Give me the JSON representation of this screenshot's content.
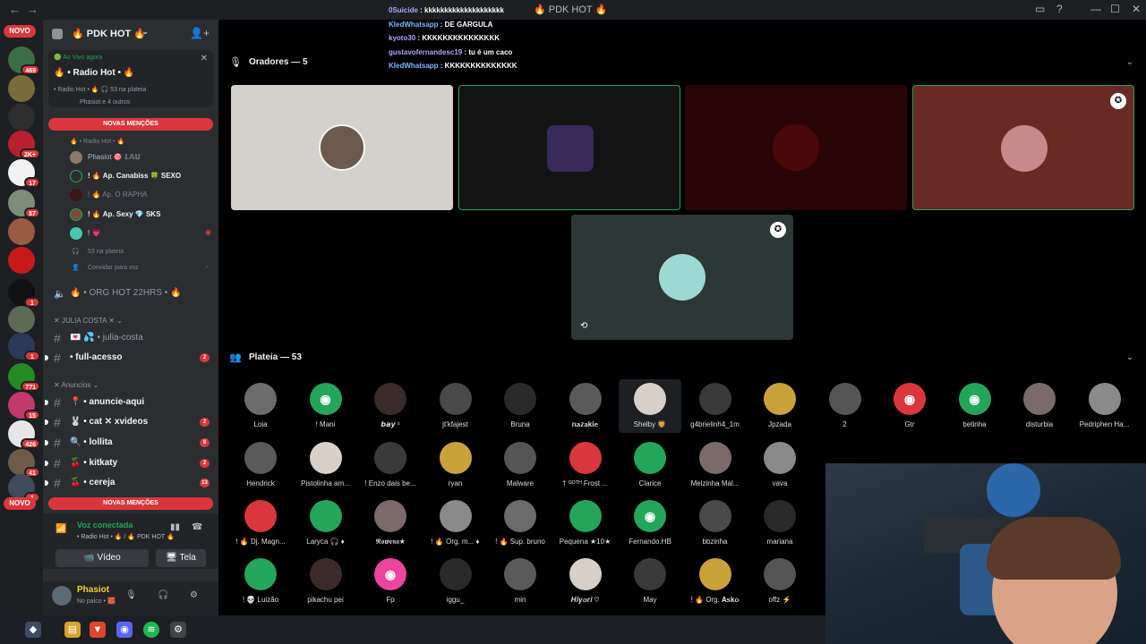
{
  "topbar": {
    "title": "🔥 PDK HOT 🔥",
    "back": "←",
    "fwd": "→",
    "inbox_icon": "inbox-icon",
    "help_icon": "help-icon",
    "minimize": "—",
    "maximize": "☐",
    "close": "✕"
  },
  "rail": {
    "new_pill": "NOVO",
    "new_pill_bottom": "NOVO",
    "badges": [
      "469",
      "2K+",
      "17",
      "87",
      "1",
      "1",
      "771",
      "15",
      "426",
      "41",
      "1"
    ]
  },
  "guild": {
    "name": "🔥 PDK HOT 🔥",
    "chevron": "⌄",
    "invite_icon": "add-user-icon"
  },
  "live": {
    "label": "🟢 Ao Vivo agora",
    "title": "🔥 • Radio Hot • 🔥",
    "sub": "• Radio Hot • 🔥   🎧 53 na plateia",
    "others": "Phasiot e 4 outros",
    "close": "✕"
  },
  "mentions": {
    "label": "NOVAS MENÇÕES"
  },
  "voice": {
    "stage_name": "🔥 • Radio Hot • 🔥",
    "members": [
      {
        "name": "Phasiot  🎯 𝕃𝔸𝕌"
      },
      {
        "name": "! 🔥 Ap. Canabiss  🍀 SEXO"
      },
      {
        "name": "! 🔥 Ap. O RAPHA"
      },
      {
        "name": "! 🔥 Ap. Sexy  💎 SKS"
      },
      {
        "name": "! 💗"
      }
    ],
    "audience": "53 na plateia",
    "invite": "Convidar para voz"
  },
  "channels": {
    "org": "🔥 • ORG HOT 22HRS • 🔥",
    "cat_julia": "JULIA COSTA",
    "julia": "💌 💦 • julia-costa",
    "full": "• full-acesso",
    "full_badge": "2",
    "cat_anuncios": "Anuncios",
    "list": [
      {
        "name": "📍 • anuncie-aqui",
        "badge": ""
      },
      {
        "name": "🐰 • cat ✕ xvideos",
        "badge": "2"
      },
      {
        "name": "🔍 • lollita",
        "badge": "8"
      },
      {
        "name": "🍒 • kitkaty",
        "badge": "2"
      },
      {
        "name": "🍒 • cereja",
        "badge": "13"
      }
    ]
  },
  "voice_panel": {
    "status": "Voz conectada",
    "where": "• Radio Hot • 🔥 / 🔥 PDK HOT 🔥",
    "video": "Vídeo",
    "screen": "Tela"
  },
  "user": {
    "name": "Phasiot",
    "status": "No palco • 🧱"
  },
  "chat": [
    {
      "user": "0Suicide",
      "msg": "kkkkkkkkkkkkkkkkkkkk"
    },
    {
      "user": "KledWhatsapp",
      "msg": "DE GARGULA"
    },
    {
      "user": "kyoto30",
      "msg": "KKKKKKKKKKKKKKK"
    },
    {
      "user": "gustavofernandesc19",
      "msg": "tu é um caco"
    },
    {
      "user": "KledWhatsapp",
      "msg": "KKKKKKKKKKKKKK"
    }
  ],
  "stage": {
    "speakers_label": "Oradores — 5",
    "audience_label": "Plateia — 53"
  },
  "audience": [
    [
      "Loia",
      "! Mani",
      "𝙗𝙖𝙮 ˢ",
      "jt'kfajest",
      "Bruna",
      "𝐧𝐚𝐳𝐚𝐤𝐢𝐞",
      "Shelby 🦁",
      "g4brielinh4_1m",
      "Jpzada",
      "2",
      "Gtr",
      "betinha",
      "disturbia",
      "Pedriphen Ha..."
    ],
    [
      "Hendrick",
      "Pistolinha am...",
      "! Enzo dais be...",
      "ryan",
      "Malware",
      "† ᴳᴼᵀᴴ Frost ...",
      "Clarice",
      "Melzinha Mal...",
      "vava"
    ],
    [
      "! 🔥 Dj. Magn...",
      "Laryca 🎧 ♦",
      "𝕽𝖔𝖜𝖊𝖓𝖆★",
      "! 🔥 Org. m... ♦",
      "! 🔥 Sup. bruno",
      "Pequena ★10★",
      "Fernando.HB",
      "bbzinha",
      "mariana"
    ],
    [
      "! 💀 Luizão",
      "pikachu pei",
      "Fp",
      "iggu_",
      "min",
      "𝑯𝒊𝒚𝒐𝒓𝒊 ♡",
      "May",
      "! 🔥 Org. 𝐀𝐬𝐤𝐨",
      "offz ⚡"
    ]
  ],
  "colors": {
    "discord_blurple": "#5865f2",
    "discord_green": "#23a55a",
    "discord_red": "#da373c"
  }
}
